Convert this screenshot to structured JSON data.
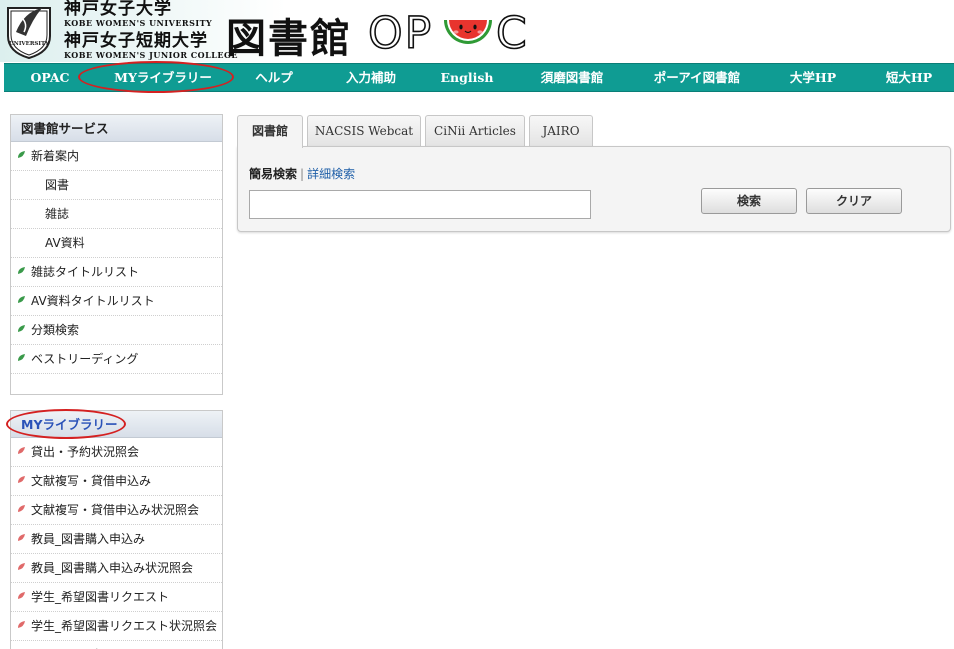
{
  "header": {
    "university_jp": "神戸女子大学",
    "university_en": "KOBE WOMEN'S UNIVERSITY",
    "college_jp": "神戸女子短期大学",
    "college_en": "KOBE WOMEN'S JUNIOR COLLEGE",
    "title": "図書館",
    "opac_prefix": "OP",
    "opac_suffix": "C",
    "emblem_text": "UNIVERSITY"
  },
  "nav": {
    "items": [
      {
        "label": "OPAC"
      },
      {
        "label": "MYライブラリー"
      },
      {
        "label": "ヘルプ"
      },
      {
        "label": "入力補助"
      },
      {
        "label": "English"
      },
      {
        "label": "須磨図書館"
      },
      {
        "label": "ポーアイ図書館"
      },
      {
        "label": "大学HP"
      },
      {
        "label": "短大HP"
      }
    ]
  },
  "sidebar": {
    "services": {
      "heading": "図書館サービス",
      "items": [
        {
          "label": "新着案内"
        },
        {
          "label": "図書"
        },
        {
          "label": "雑誌"
        },
        {
          "label": "AV資料"
        },
        {
          "label": "雑誌タイトルリスト"
        },
        {
          "label": "AV資料タイトルリスト"
        },
        {
          "label": "分類検索"
        },
        {
          "label": "ベストリーディング"
        }
      ]
    },
    "mylibrary": {
      "heading": "MYライブラリー",
      "items": [
        {
          "label": "貸出・予約状況照会"
        },
        {
          "label": "文献複写・貸借申込み"
        },
        {
          "label": "文献複写・貸借申込み状況照会"
        },
        {
          "label": "教員_図書購入申込み"
        },
        {
          "label": "教員_図書購入申込み状況照会"
        },
        {
          "label": "学生_希望図書リクエスト"
        },
        {
          "label": "学生_希望図書リクエスト状況照会"
        },
        {
          "label": "パスワード変更"
        }
      ]
    }
  },
  "search": {
    "tabs": [
      {
        "label": "図書館"
      },
      {
        "label": "NACSIS Webcat"
      },
      {
        "label": "CiNii Articles"
      },
      {
        "label": "JAIRO"
      }
    ],
    "mode_current": "簡易検索",
    "mode_separator": "|",
    "mode_link": "詳細検索",
    "query_value": "",
    "search_button": "検索",
    "clear_button": "クリア"
  },
  "colors": {
    "nav_bg": "#0f9c93",
    "highlight_oval": "#d42121",
    "bullet_green": "#3a9a4a",
    "bullet_red": "#e06a6a",
    "link_blue": "#1f5fa8"
  }
}
